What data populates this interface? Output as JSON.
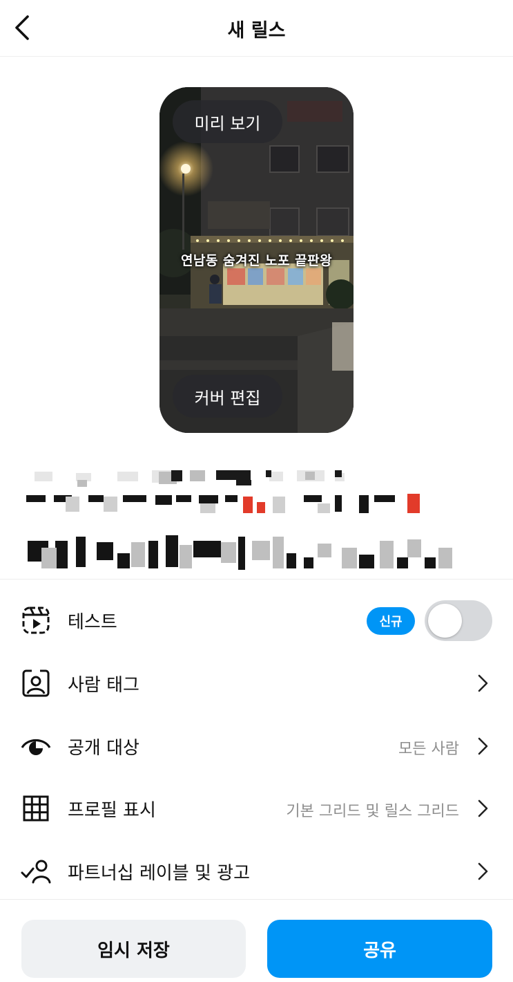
{
  "header": {
    "title": "새 릴스"
  },
  "preview": {
    "preview_label": "미리 보기",
    "cover_label": "커버 편집",
    "overlay_text": "연남동 숨겨진 노포 끝판왕"
  },
  "options": [
    {
      "label": "테스트",
      "icon": "reels-icon",
      "badge": "신규",
      "toggle_on": false
    },
    {
      "label": "사람 태그",
      "icon": "tag-people-icon",
      "value": ""
    },
    {
      "label": "공개 대상",
      "icon": "eye-icon",
      "value": "모든 사람"
    },
    {
      "label": "프로필 표시",
      "icon": "grid-icon",
      "value": "기본 그리드 및 릴스 그리드"
    },
    {
      "label": "파트너십 레이블 및 광고",
      "icon": "partnership-icon",
      "value": ""
    }
  ],
  "buttons": {
    "draft": "임시 저장",
    "share": "공유"
  },
  "colors": {
    "accent": "#0095f6",
    "toggle_off": "#d7d9dc",
    "secondary_button": "#eff1f3"
  }
}
